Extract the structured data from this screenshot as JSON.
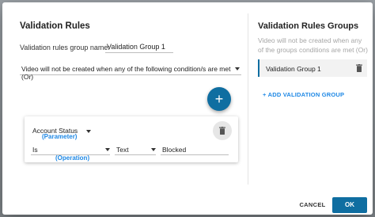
{
  "dialog": {
    "title": "Validation Rules",
    "group_name_label": "Validation rules group name:",
    "group_name_value": "Validation Group 1",
    "condition_mode": "Video will not be created when any of the following condition/s are met (Or)",
    "add_icon": "plus-icon",
    "rule": {
      "parameter": "Account Status",
      "parameter_hint": "(Parameter)",
      "operation": "Is",
      "operation_hint": "(Operation)",
      "type": "Text",
      "value": "Blocked",
      "delete_icon": "trash-icon"
    }
  },
  "groups_panel": {
    "title": "Validation Rules Groups",
    "description": "Video will not be created when any of the groups conditions are met (Or)",
    "items": [
      {
        "label": "Validation Group 1",
        "icon": "trash-icon"
      }
    ],
    "add_group_label": "+ ADD VALIDATION GROUP"
  },
  "footer": {
    "cancel_label": "CANCEL",
    "ok_label": "OK"
  },
  "colors": {
    "accent": "#0f6ea1",
    "link": "#1e88e5"
  }
}
